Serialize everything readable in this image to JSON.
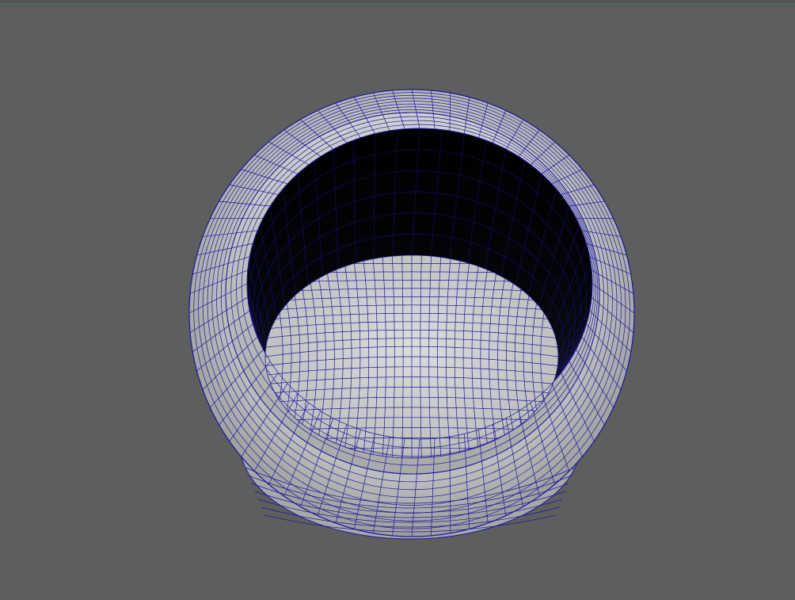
{
  "viewport": {
    "background": "#5e5e5e",
    "object": "pot-mesh",
    "shading": "wireframe-on-shaded",
    "wire_color": "#1a1a9a",
    "surface_color": "#c4c4c4"
  }
}
